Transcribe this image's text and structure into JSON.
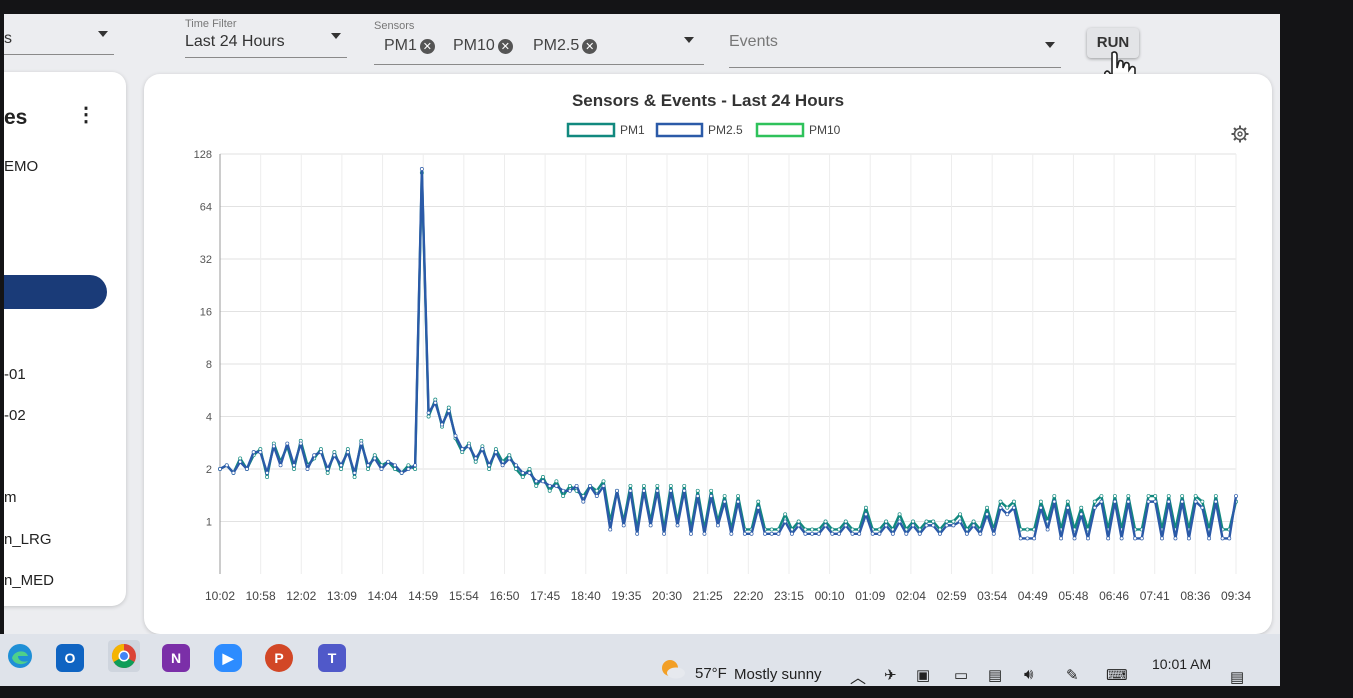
{
  "filters": {
    "first_dropdown_value": "s",
    "time_filter": {
      "label": "Time Filter",
      "value": "Last 24 Hours"
    },
    "sensors": {
      "label": "Sensors",
      "chips": [
        "PM1",
        "PM10",
        "PM2.5"
      ]
    },
    "events": {
      "placeholder": "Events"
    },
    "run_label": "RUN"
  },
  "sidebar": {
    "header": "es",
    "item_demo": "EMO",
    "items": [
      "-01",
      "-02",
      "m",
      "n_LRG",
      "n_MED"
    ]
  },
  "chart_data": {
    "type": "line",
    "title": "Sensors & Events - Last 24 Hours",
    "ylabel": "",
    "xlabel": "",
    "y_scale": "log2",
    "ylim": [
      0.5,
      128
    ],
    "y_ticks": [
      "1",
      "2",
      "4",
      "8",
      "16",
      "32",
      "64",
      "128"
    ],
    "grid": true,
    "legend_position": "top-center",
    "x_ticks": [
      "10:02",
      "10:58",
      "12:02",
      "13:09",
      "14:04",
      "14:59",
      "15:54",
      "16:50",
      "17:45",
      "18:40",
      "19:35",
      "20:30",
      "21:25",
      "22:20",
      "23:15",
      "00:10",
      "01:09",
      "02:04",
      "02:59",
      "03:54",
      "04:49",
      "05:48",
      "06:46",
      "07:41",
      "08:36",
      "09:34"
    ],
    "series": [
      {
        "name": "PM1",
        "color": "#12897f",
        "values": [
          2.0,
          2.1,
          1.9,
          2.3,
          2.0,
          2.4,
          2.6,
          1.8,
          2.8,
          2.2,
          2.7,
          2.0,
          2.9,
          2.1,
          2.3,
          2.6,
          1.9,
          2.5,
          2.0,
          2.6,
          1.8,
          2.9,
          2.0,
          2.4,
          2.1,
          2.2,
          2.0,
          1.9,
          2.1,
          2.0,
          100,
          4.0,
          5.0,
          3.5,
          4.5,
          3.0,
          2.5,
          2.8,
          2.2,
          2.7,
          2.0,
          2.6,
          2.2,
          2.4,
          2.0,
          1.8,
          2.0,
          1.6,
          1.8,
          1.5,
          1.7,
          1.4,
          1.6,
          1.5,
          1.4,
          1.6,
          1.5,
          1.7,
          1.0,
          1.5,
          1.0,
          1.6,
          0.9,
          1.6,
          1.0,
          1.6,
          0.9,
          1.6,
          1.0,
          1.6,
          0.9,
          1.5,
          0.9,
          1.5,
          1.0,
          1.4,
          0.9,
          1.4,
          0.9,
          0.9,
          1.3,
          0.9,
          0.9,
          0.9,
          1.1,
          0.9,
          1.0,
          0.9,
          0.9,
          0.9,
          1.0,
          0.9,
          0.9,
          1.0,
          0.9,
          0.9,
          1.2,
          0.9,
          0.9,
          1.0,
          0.9,
          1.1,
          0.9,
          1.0,
          0.9,
          1.0,
          1.0,
          0.9,
          1.0,
          1.0,
          1.1,
          0.9,
          1.0,
          0.9,
          1.2,
          0.9,
          1.3,
          1.2,
          1.3,
          0.9,
          0.9,
          0.9,
          1.3,
          1.0,
          1.4,
          0.9,
          1.3,
          0.9,
          1.2,
          0.9,
          1.3,
          1.4,
          0.9,
          1.4,
          0.9,
          1.4,
          0.9,
          0.9,
          1.4,
          1.4,
          0.9,
          1.4,
          0.9,
          1.4,
          0.9,
          1.4,
          1.3,
          0.9,
          1.4,
          0.9,
          0.9,
          1.3
        ]
      },
      {
        "name": "PM2.5",
        "color": "#2b5aa8",
        "values": [
          2.0,
          2.1,
          1.9,
          2.2,
          2.0,
          2.5,
          2.5,
          1.9,
          2.7,
          2.1,
          2.8,
          2.1,
          2.8,
          2.0,
          2.4,
          2.5,
          2.0,
          2.4,
          2.1,
          2.5,
          1.9,
          2.8,
          2.1,
          2.3,
          2.0,
          2.2,
          2.1,
          1.9,
          2.0,
          2.1,
          105,
          4.2,
          4.8,
          3.6,
          4.3,
          3.1,
          2.6,
          2.7,
          2.3,
          2.6,
          2.1,
          2.5,
          2.1,
          2.3,
          2.1,
          1.9,
          1.9,
          1.7,
          1.7,
          1.6,
          1.6,
          1.5,
          1.5,
          1.6,
          1.3,
          1.6,
          1.4,
          1.6,
          0.9,
          1.5,
          0.95,
          1.5,
          0.85,
          1.5,
          0.95,
          1.5,
          0.85,
          1.5,
          0.95,
          1.5,
          0.85,
          1.4,
          0.85,
          1.4,
          0.95,
          1.3,
          0.85,
          1.3,
          0.85,
          0.85,
          1.2,
          0.85,
          0.85,
          0.85,
          1.0,
          0.85,
          0.95,
          0.85,
          0.85,
          0.85,
          0.95,
          0.85,
          0.85,
          0.95,
          0.85,
          0.85,
          1.1,
          0.85,
          0.85,
          0.95,
          0.85,
          1.0,
          0.85,
          0.95,
          0.85,
          0.95,
          0.95,
          0.85,
          0.95,
          0.95,
          1.0,
          0.85,
          0.95,
          0.85,
          1.1,
          0.85,
          1.2,
          1.1,
          1.2,
          0.8,
          0.8,
          0.8,
          1.2,
          0.9,
          1.3,
          0.8,
          1.2,
          0.8,
          1.1,
          0.8,
          1.2,
          1.3,
          0.8,
          1.3,
          0.8,
          1.3,
          0.8,
          0.8,
          1.3,
          1.3,
          0.8,
          1.3,
          0.8,
          1.3,
          0.8,
          1.3,
          1.2,
          0.8,
          1.3,
          0.8,
          0.8,
          1.4
        ]
      },
      {
        "name": "PM10",
        "color": "#2fc25b",
        "values": []
      }
    ]
  },
  "taskbar": {
    "weather_temp": "57°F",
    "weather_text": "Mostly sunny",
    "time": "10:01 AM",
    "apps": [
      "outlook-icon",
      "chrome-icon",
      "onenote-icon",
      "zoom-icon",
      "powerpoint-icon",
      "teams-icon"
    ]
  }
}
